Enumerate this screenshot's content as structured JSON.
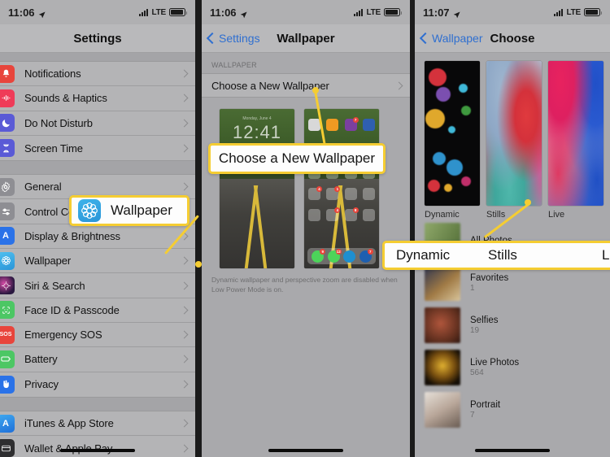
{
  "panels": [
    {
      "id": "settings",
      "status": {
        "time": "11:06",
        "carrier": "LTE",
        "location_icon": "location-arrow-icon"
      },
      "nav": {
        "title": "Settings",
        "back": ""
      },
      "groups": [
        {
          "rows": [
            {
              "label": "Notifications",
              "icon": "notifications-icon",
              "color": "#e8453c",
              "glyph": ""
            },
            {
              "label": "Sounds & Haptics",
              "icon": "sounds-haptics-icon",
              "color": "#ef3b58",
              "glyph": ""
            },
            {
              "label": "Do Not Disturb",
              "icon": "do-not-disturb-icon",
              "color": "#5a5ad6",
              "glyph": ""
            },
            {
              "label": "Screen Time",
              "icon": "screen-time-icon",
              "color": "#5a5ad6",
              "glyph": ""
            }
          ]
        },
        {
          "rows": [
            {
              "label": "General",
              "icon": "general-icon",
              "color": "#8e8e93",
              "glyph": ""
            },
            {
              "label": "Control Cent",
              "icon": "control-center-icon",
              "color": "#8e8e93",
              "glyph": ""
            },
            {
              "label": "Display & Brightness",
              "icon": "display-brightness-icon",
              "color": "#2a72e8",
              "glyph": "A"
            },
            {
              "label": "Wallpaper",
              "icon": "wallpaper-icon",
              "color": "#3fb3ea",
              "glyph": ""
            },
            {
              "label": "Siri & Search",
              "icon": "siri-search-icon",
              "color": "#2a2040",
              "glyph": ""
            },
            {
              "label": "Face ID & Passcode",
              "icon": "face-id-icon",
              "color": "#4cc764",
              "glyph": ""
            },
            {
              "label": "Emergency SOS",
              "icon": "emergency-sos-icon",
              "color": "#e8453c",
              "glyph": "SOS"
            },
            {
              "label": "Battery",
              "icon": "battery-icon",
              "color": "#4cc764",
              "glyph": ""
            },
            {
              "label": "Privacy",
              "icon": "privacy-icon",
              "color": "#2a72e8",
              "glyph": ""
            }
          ]
        },
        {
          "rows": [
            {
              "label": "iTunes & App Store",
              "icon": "itunes-app-store-icon",
              "color": "#2a9ce8",
              "glyph": "A"
            },
            {
              "label": "Wallet & Apple Pay",
              "icon": "wallet-apple-pay-icon",
              "color": "#2e2e30",
              "glyph": ""
            }
          ]
        }
      ]
    },
    {
      "id": "wallpaper",
      "status": {
        "time": "11:06",
        "carrier": "LTE"
      },
      "nav": {
        "title": "Wallpaper",
        "back": "Settings"
      },
      "section_header": "WALLPAPER",
      "choose_row": "Choose a New Wallpaper",
      "lock_preview": {
        "clock": "12:41",
        "date": "Monday, June 4"
      },
      "footnote": "Dynamic wallpaper and perspective zoom are disabled when Low Power Mode is on."
    },
    {
      "id": "choose",
      "status": {
        "time": "11:07",
        "carrier": "LTE"
      },
      "nav": {
        "title": "Choose",
        "back": "Wallpaper"
      },
      "thumbs": [
        {
          "label": "Dynamic",
          "name": "wallpaper-type-dynamic"
        },
        {
          "label": "Stills",
          "name": "wallpaper-type-stills"
        },
        {
          "label": "Live",
          "name": "wallpaper-type-live"
        }
      ],
      "albums": [
        {
          "name": "All Photos",
          "count": "",
          "color": "#5f7a3e"
        },
        {
          "name": "Favorites",
          "count": "1",
          "color": "#6a5338"
        },
        {
          "name": "Selfies",
          "count": "19",
          "color": "#53341f"
        },
        {
          "name": "Live Photos",
          "count": "564",
          "color": "#3a2a12"
        },
        {
          "name": "Portrait",
          "count": "7",
          "color": "#a39486"
        }
      ]
    }
  ],
  "callouts": [
    {
      "id": "callout-wallpaper",
      "text": "Wallpaper",
      "icon": "wallpaper-app-icon",
      "border": "#f5cd32"
    },
    {
      "id": "callout-choose",
      "text": "Choose a New Wallpaper",
      "border": "#f5cd32"
    },
    {
      "id": "callout-tabs",
      "items": [
        "Dynamic",
        "Stills",
        "Live"
      ],
      "border": "#f5cd32"
    }
  ]
}
